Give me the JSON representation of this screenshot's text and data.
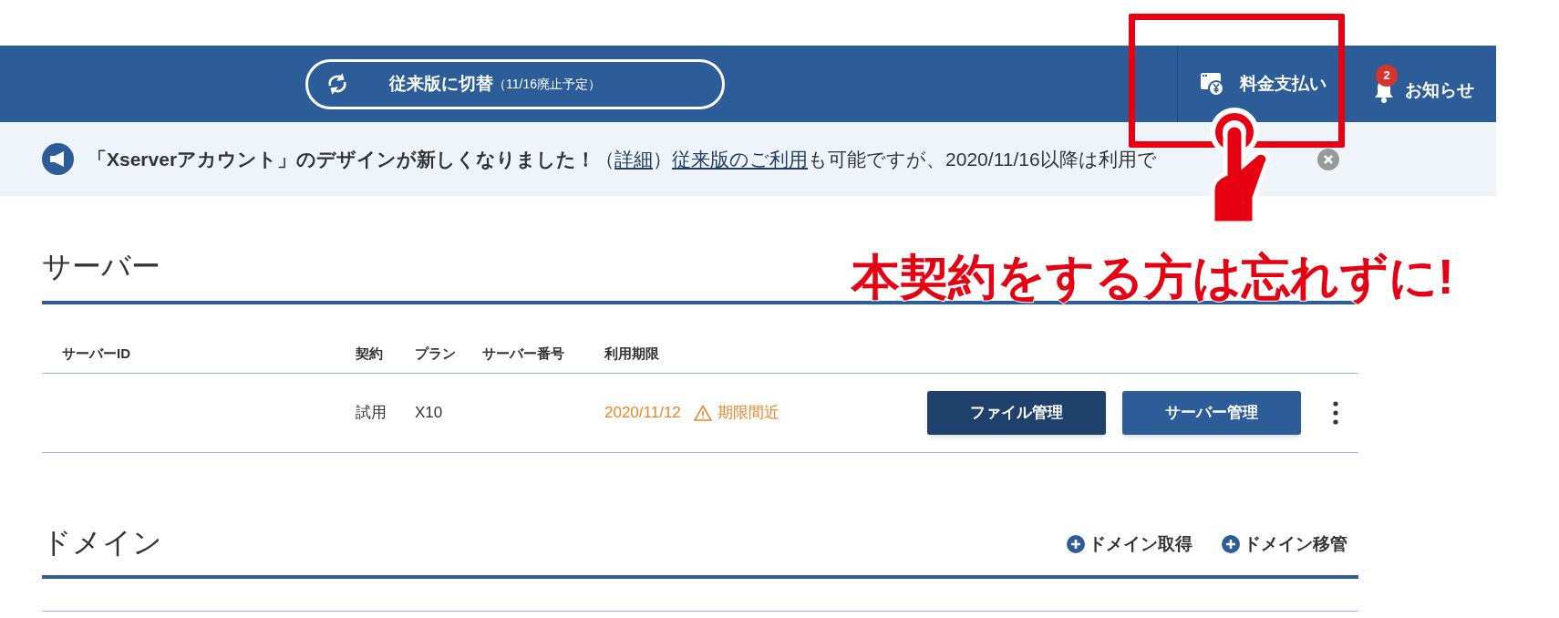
{
  "header": {
    "switch_button": {
      "label": "従来版に切替",
      "note": "（11/16廃止予定）"
    },
    "payment": {
      "label": "料金支払い"
    },
    "notifications": {
      "label": "お知らせ",
      "badge": "2"
    }
  },
  "notice": {
    "segments": [
      {
        "kind": "bold",
        "text": "「Xserverアカウント」のデザインが新しくなりました！"
      },
      {
        "kind": "text",
        "text": "（"
      },
      {
        "kind": "link",
        "text": "詳細"
      },
      {
        "kind": "text",
        "text": "）"
      },
      {
        "kind": "link",
        "text": "従来版のご利用"
      },
      {
        "kind": "text",
        "text": "も可能ですが、2020/11/16以降は利用で"
      }
    ]
  },
  "annotation": {
    "text": "本契約をする方は忘れずに!"
  },
  "servers": {
    "title": "サーバー",
    "columns": [
      "サーバーID",
      "契約",
      "プラン",
      "サーバー番号",
      "利用期限"
    ],
    "rows": [
      {
        "contract": "試用",
        "plan": "X10",
        "expiry": "2020/11/12",
        "warning": "期限間近",
        "buttons": [
          {
            "label": "ファイル管理",
            "kind": "dark"
          },
          {
            "label": "サーバー管理",
            "kind": "primary"
          }
        ]
      }
    ]
  },
  "domains": {
    "title": "ドメイン",
    "actions": [
      "ドメイン取得",
      "ドメイン移管"
    ]
  }
}
